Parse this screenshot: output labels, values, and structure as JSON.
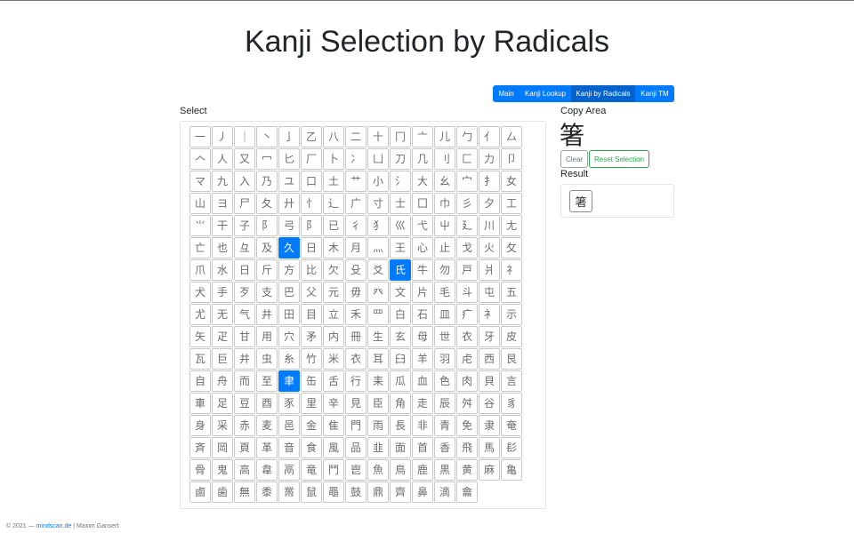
{
  "page": {
    "title": "Kanji Selection by Radicals"
  },
  "nav": {
    "items": [
      {
        "label": "Main",
        "active": false
      },
      {
        "label": "Kanji Lookup",
        "active": false
      },
      {
        "label": "Kanji by Radicals",
        "active": true
      },
      {
        "label": "Kanji TM",
        "active": false
      }
    ]
  },
  "select": {
    "label": "Select",
    "radicals": [
      "一",
      "丿",
      "｜",
      "丶",
      "亅",
      "乙",
      "八",
      "二",
      "十",
      "冂",
      "亠",
      "儿",
      "勹",
      "亻",
      "厶",
      "𠆢",
      "人",
      "又",
      "冖",
      "匕",
      "厂",
      "卜",
      "冫",
      "凵",
      "刀",
      "几",
      "刂",
      "匚",
      "力",
      "卩",
      "マ",
      "九",
      "入",
      "乃",
      "ユ",
      "口",
      "土",
      "艹",
      "小",
      "氵",
      "大",
      "幺",
      "宀",
      "扌",
      "女",
      "山",
      "ヨ",
      "尸",
      "夂",
      "廾",
      "忄",
      "辶",
      "广",
      "寸",
      "士",
      "囗",
      "巾",
      "彡",
      "夕",
      "工",
      "⺌",
      "干",
      "子",
      "阝",
      "弓",
      "阝",
      "已",
      "彳",
      "犭",
      "巛",
      "弋",
      "屮",
      "廴",
      "川",
      "尢",
      "亡",
      "也",
      "彑",
      "及",
      "久",
      "日",
      "木",
      "月",
      "灬",
      "王",
      "心",
      "止",
      "戈",
      "火",
      "攵",
      "爪",
      "水",
      "日",
      "斤",
      "方",
      "比",
      "欠",
      "殳",
      "爻",
      "氏",
      "牛",
      "勿",
      "戸",
      "爿",
      "礻",
      "犬",
      "手",
      "歹",
      "支",
      "巴",
      "父",
      "元",
      "毋",
      "癶",
      "文",
      "片",
      "毛",
      "斗",
      "屯",
      "五",
      "尤",
      "无",
      "气",
      "井",
      "田",
      "目",
      "立",
      "禾",
      "罒",
      "白",
      "石",
      "皿",
      "疒",
      "衤",
      "示",
      "矢",
      "疋",
      "甘",
      "用",
      "穴",
      "矛",
      "内",
      "冊",
      "生",
      "玄",
      "母",
      "世",
      "衣",
      "牙",
      "皮",
      "瓦",
      "巨",
      "井",
      "虫",
      "糸",
      "竹",
      "米",
      "衣",
      "耳",
      "臼",
      "羊",
      "羽",
      "虍",
      "西",
      "艮",
      "自",
      "舟",
      "而",
      "至",
      "聿",
      "缶",
      "舌",
      "行",
      "耒",
      "瓜",
      "血",
      "色",
      "肉",
      "貝",
      "言",
      "車",
      "足",
      "豆",
      "酉",
      "豕",
      "里",
      "辛",
      "見",
      "臣",
      "角",
      "走",
      "辰",
      "舛",
      "谷",
      "豸",
      "身",
      "采",
      "赤",
      "麦",
      "邑",
      "金",
      "隹",
      "門",
      "雨",
      "長",
      "非",
      "青",
      "免",
      "隶",
      "奄",
      "斉",
      "岡",
      "頁",
      "革",
      "音",
      "食",
      "風",
      "品",
      "韭",
      "面",
      "首",
      "香",
      "飛",
      "馬",
      "髟",
      "骨",
      "鬼",
      "高",
      "韋",
      "鬲",
      "竜",
      "鬥",
      "鬯",
      "魚",
      "鳥",
      "鹿",
      "黒",
      "黄",
      "麻",
      "亀",
      "鹵",
      "歯",
      "無",
      "黍",
      "黹",
      "鼠",
      "黽",
      "鼓",
      "鼎",
      "齊",
      "鼻",
      "滴",
      "龠"
    ],
    "selected_indices": [
      79,
      99,
      169
    ]
  },
  "copy_area": {
    "label": "Copy Area",
    "text": "箸",
    "clear_label": "Clear",
    "reset_label": "Reset Selection"
  },
  "result": {
    "label": "Result",
    "items": [
      "箸"
    ]
  },
  "footer": {
    "prefix": "© 2021 —",
    "link": "mindscan.de",
    "suffix": "| Maxim Gansert"
  }
}
